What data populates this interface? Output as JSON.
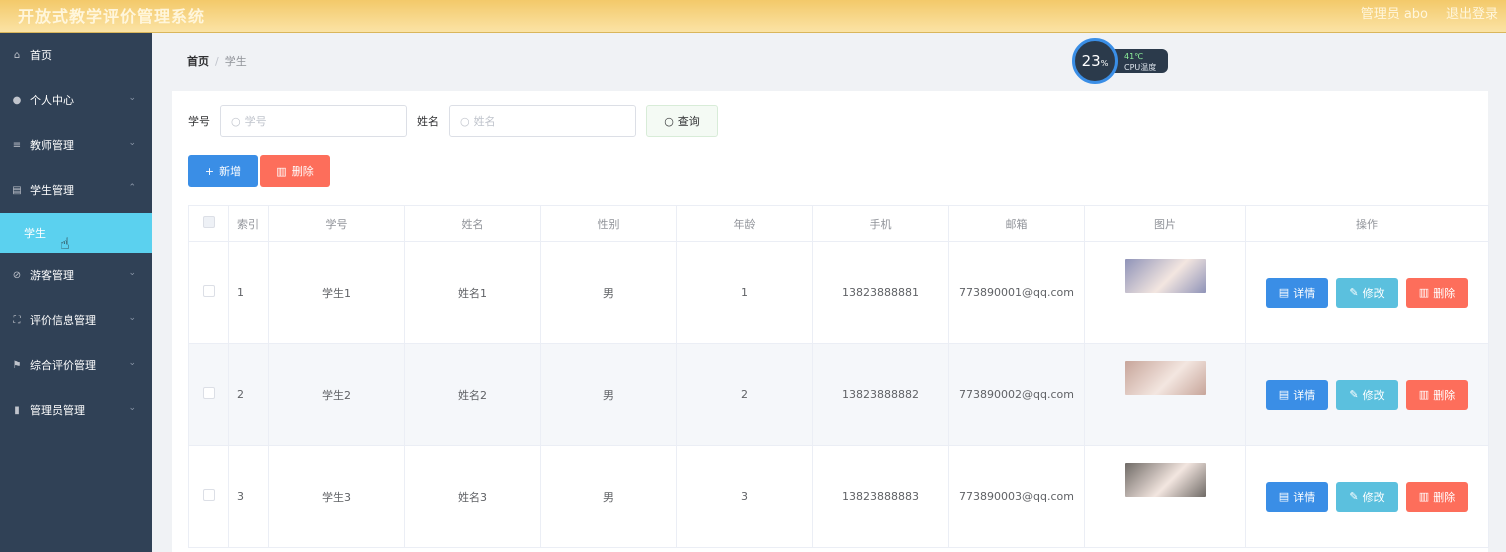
{
  "header": {
    "title": "开放式教学评价管理系统",
    "admin": "管理员 abo",
    "logout": "退出登录"
  },
  "sidebar": {
    "items": [
      {
        "label": "首页",
        "icon": "home-icon",
        "glyph": "⌂",
        "arrow": ""
      },
      {
        "label": "个人中心",
        "icon": "user-icon",
        "glyph": "●",
        "arrow": "⌄"
      },
      {
        "label": "教师管理",
        "icon": "list-icon",
        "glyph": "≡",
        "arrow": "⌄"
      },
      {
        "label": "学生管理",
        "icon": "clipboard-icon",
        "glyph": "▤",
        "arrow": "⌃"
      },
      {
        "label": "学生",
        "icon": "",
        "glyph": "",
        "arrow": ""
      },
      {
        "label": "游客管理",
        "icon": "compass-icon",
        "glyph": "⊘",
        "arrow": "⌄"
      },
      {
        "label": "评价信息管理",
        "icon": "fullscreen-icon",
        "glyph": "⛶",
        "arrow": "⌄"
      },
      {
        "label": "综合评价管理",
        "icon": "flag-icon",
        "glyph": "⚑",
        "arrow": "⌄"
      },
      {
        "label": "管理员管理",
        "icon": "bar-chart-icon",
        "glyph": "▮",
        "arrow": "⌄"
      }
    ]
  },
  "breadcrumb": {
    "home": "首页",
    "sep": "/",
    "current": "学生"
  },
  "cpu": {
    "percent": "23",
    "unit": "%",
    "temp": "41℃",
    "label": "CPU温度"
  },
  "search": {
    "student_no_label": "学号",
    "student_no_placeholder": "学号",
    "name_label": "姓名",
    "name_placeholder": "姓名",
    "query_label": "查询"
  },
  "actions": {
    "add_label": "新增",
    "delete_label": "删除"
  },
  "table": {
    "headers": [
      "索引",
      "学号",
      "姓名",
      "性别",
      "年龄",
      "手机",
      "邮箱",
      "图片",
      "操作"
    ],
    "rows": [
      {
        "index": "1",
        "student_no": "学生1",
        "name": "姓名1",
        "gender": "男",
        "age": "1",
        "phone": "13823888881",
        "email": "773890001@qq.com",
        "photo_color": "#8f93b8"
      },
      {
        "index": "2",
        "student_no": "学生2",
        "name": "姓名2",
        "gender": "男",
        "age": "2",
        "phone": "13823888882",
        "email": "773890002@qq.com",
        "photo_color": "#c7a59a"
      },
      {
        "index": "3",
        "student_no": "学生3",
        "name": "姓名3",
        "gender": "男",
        "age": "3",
        "phone": "13823888883",
        "email": "773890003@qq.com",
        "photo_color": "#6f6a66"
      }
    ],
    "row_actions": {
      "detail": "详情",
      "edit": "修改",
      "delete": "删除"
    }
  }
}
